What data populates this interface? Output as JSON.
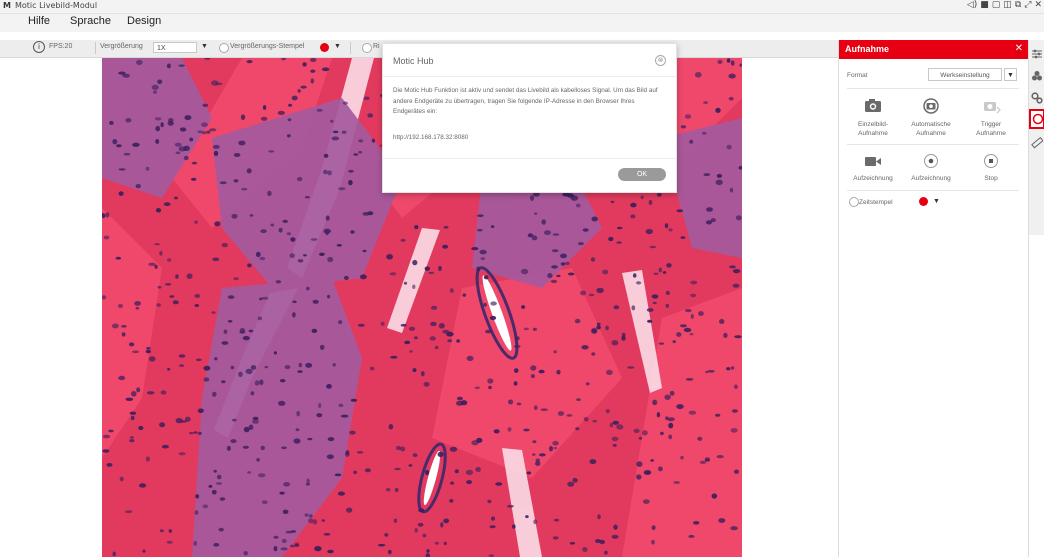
{
  "window": {
    "logo": "M",
    "title": "Motic Livebild-Modul",
    "controls": [
      "◁)",
      "■",
      "▢",
      "◫",
      "⧉",
      "⤢",
      "✕"
    ]
  },
  "menu": {
    "items": [
      "Hilfe",
      "Sprache",
      "Design"
    ]
  },
  "toolbar": {
    "info_icon": "info-icon",
    "fps": "FPS:20",
    "magnification_label": "Vergrößerung",
    "magnification_value": "1X",
    "magnification_stamp_label": "Vergrößerungs-Stempel",
    "stamp_color": "#e60012",
    "truncated_label": "Ri"
  },
  "dialog": {
    "title": "Motic Hub",
    "message": "Die Motic Hub Funktion ist aktiv und sendet das Livebild als kabelloses Signal. Um das Bild auf andere Endgeräte zu übertragen, tragen Sie folgende IP-Adresse in den Browser Ihres Endgerätes ein:",
    "url": "http://192.168.178.32:8080",
    "ok_label": "OK"
  },
  "panel": {
    "title": "Aufnahme",
    "format_label": "Format",
    "format_value": "Werkseinstellung",
    "capture_buttons": [
      {
        "label": "Einzelbild-\nAufnahme",
        "icon": "camera-icon"
      },
      {
        "label": "Automatische\nAufnahme",
        "icon": "auto-camera-icon"
      },
      {
        "label": "Trigger\nAufnahme",
        "icon": "trigger-camera-icon"
      }
    ],
    "record_buttons": [
      {
        "label": "Aufzeichnung",
        "icon": "video-camera-icon"
      },
      {
        "label": "Aufzeichnung",
        "icon": "record-icon"
      },
      {
        "label": "Stop",
        "icon": "stop-icon"
      }
    ],
    "timestamp_label": "Zeitstempel",
    "timestamp_color": "#e60012"
  },
  "side_strip": {
    "icons": [
      "sliders-icon",
      "color-icon",
      "settings-icon",
      "capture-circle-icon",
      "ruler-icon"
    ],
    "active_icon": "capture-circle-icon",
    "accent": "#e60012"
  }
}
